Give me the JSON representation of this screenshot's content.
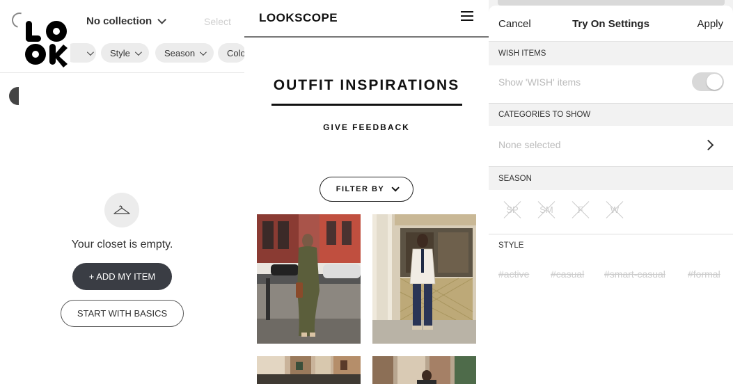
{
  "panel1": {
    "collection_label": "No collection",
    "select_label": "Select",
    "filter_pills": [
      {
        "label": ""
      },
      {
        "label": "Style"
      },
      {
        "label": "Season"
      },
      {
        "label": "Colo"
      }
    ],
    "empty_message": "Your closet is empty.",
    "add_item_label": "+ ADD MY ITEM",
    "basics_label": "START WITH BASICS",
    "icons": [
      "loading-spinner-icon",
      "look-logo",
      "chevron-down-icon",
      "hanger-icon"
    ]
  },
  "panel2": {
    "brand": "LOOKSCOPE",
    "page_title": "OUTFIT INSPIRATIONS",
    "feedback_label": "GIVE FEEDBACK",
    "filter_label": "FILTER BY",
    "icons": [
      "hamburger-menu-icon",
      "chevron-down-icon"
    ]
  },
  "panel3": {
    "cancel_label": "Cancel",
    "title": "Try On Settings",
    "apply_label": "Apply",
    "wish_section": "WISH ITEMS",
    "wish_toggle_label": "Show 'WISH' items",
    "wish_toggle_on": false,
    "categories_section": "CATEGORIES TO SHOW",
    "categories_value": "None selected",
    "season_section": "SEASON",
    "seasons": [
      "SP",
      "SM",
      "F",
      "W"
    ],
    "style_section": "STYLE",
    "styles": [
      "#active",
      "#casual",
      "#smart-casual",
      "#formal"
    ]
  },
  "colors": {
    "dark_button": "#3a3d44",
    "pill_bg": "#ececec",
    "settings_bg": "#f2f2f2",
    "disabled_text": "#cccccc"
  }
}
